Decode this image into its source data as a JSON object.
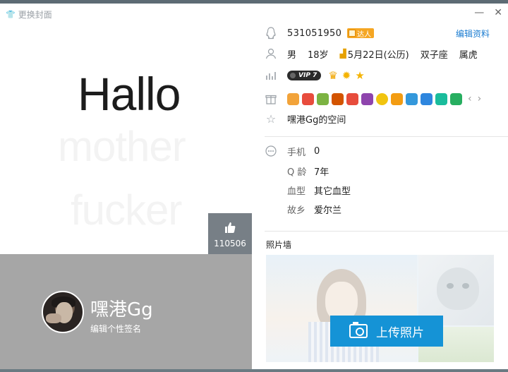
{
  "window": {
    "change_cover_label": "更换封面",
    "minimize": "—",
    "close": "✕"
  },
  "cover": {
    "headline": "Hallo",
    "ghost_line1": "mother",
    "ghost_line2": "fucker",
    "like_count": "110506"
  },
  "profile": {
    "nickname": "嘿港Gg",
    "signature_placeholder": "编辑个性签名"
  },
  "info": {
    "qq_number": "531051950",
    "daren_label": "达人",
    "edit_label": "编辑资料",
    "gender": "男",
    "age": "18岁",
    "birthday": "5月22日(公历)",
    "zodiac": "双子座",
    "chinese_zodiac": "属虎",
    "vip_label": "VIP 7",
    "qzone": "嘿港Gg的空间"
  },
  "details": {
    "phone_label": "手机",
    "phone_value": "0",
    "qage_label": "Q 龄",
    "qage_value": "7年",
    "blood_label": "血型",
    "blood_value": "其它血型",
    "hometown_label": "故乡",
    "hometown_value": "爱尔兰"
  },
  "photos": {
    "title": "照片墙",
    "upload_label": "上传照片"
  },
  "icons": {
    "badges": [
      "crown-icon",
      "sun-icon",
      "star-icon"
    ],
    "games": [
      "#f2a33a",
      "#e84c3d",
      "#7cb342",
      "#d35400",
      "#e74c3c",
      "#8e44ad",
      "#f1c40f",
      "#f39c12",
      "#3498db",
      "#2e86de",
      "#1abc9c",
      "#27ae60"
    ]
  },
  "colors": {
    "accent": "#1593d6",
    "link": "#1b7cd1",
    "band": "#a6a6a6"
  }
}
